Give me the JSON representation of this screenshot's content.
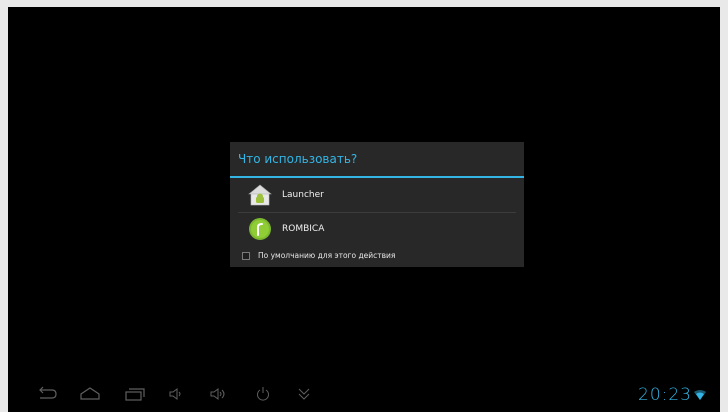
{
  "dialog": {
    "title": "Что использовать?",
    "options": [
      {
        "label": "Launcher",
        "icon": "android-home-icon"
      },
      {
        "label": "ROMBICA",
        "icon": "rombica-icon"
      }
    ],
    "default_checkbox": {
      "label": "По умолчанию для этого действия",
      "checked": false
    }
  },
  "status": {
    "time": "20:23"
  },
  "colors": {
    "accent": "#33b5e5",
    "background": "#000000",
    "dialog_bg": "#282828"
  },
  "navbar": {
    "icons": [
      "back-icon",
      "home-icon",
      "recent-apps-icon",
      "volume-down-icon",
      "volume-up-icon",
      "power-icon",
      "collapse-icon"
    ]
  }
}
